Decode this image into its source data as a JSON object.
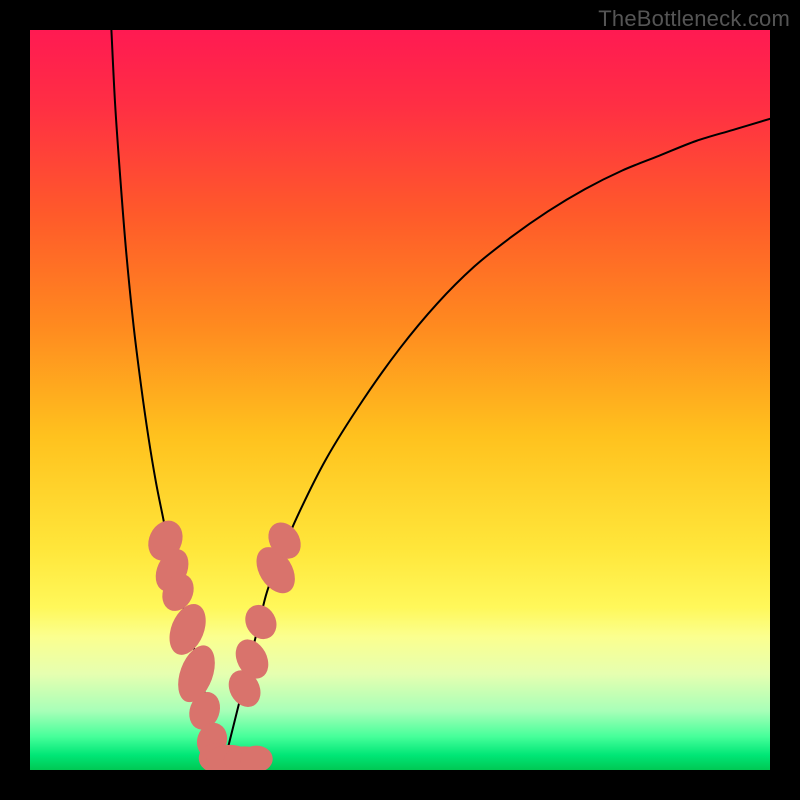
{
  "watermark": "TheBottleneck.com",
  "chart_data": {
    "type": "line",
    "title": "",
    "xlabel": "",
    "ylabel": "",
    "xlim": [
      0,
      100
    ],
    "ylim": [
      0,
      100
    ],
    "grid": false,
    "background_gradient": {
      "stops": [
        {
          "offset": 0.0,
          "color": "#ff1a52"
        },
        {
          "offset": 0.1,
          "color": "#ff2e44"
        },
        {
          "offset": 0.25,
          "color": "#ff5a2a"
        },
        {
          "offset": 0.4,
          "color": "#ff8a1f"
        },
        {
          "offset": 0.55,
          "color": "#ffc21e"
        },
        {
          "offset": 0.7,
          "color": "#ffe63a"
        },
        {
          "offset": 0.78,
          "color": "#fff85a"
        },
        {
          "offset": 0.82,
          "color": "#fbff8f"
        },
        {
          "offset": 0.87,
          "color": "#e6ffb0"
        },
        {
          "offset": 0.92,
          "color": "#a8ffb8"
        },
        {
          "offset": 0.955,
          "color": "#46ff9a"
        },
        {
          "offset": 0.98,
          "color": "#00e676"
        },
        {
          "offset": 1.0,
          "color": "#00c853"
        }
      ]
    },
    "series": [
      {
        "name": "curve-left",
        "x": [
          11,
          11.5,
          12.2,
          13,
          14,
          15,
          16,
          17,
          18,
          18.8,
          19.5,
          20.2,
          21,
          21.8,
          22.5,
          23.2,
          24,
          24.5,
          25,
          25.5,
          26
        ],
        "y": [
          100,
          90,
          80,
          70,
          60,
          52,
          45,
          39,
          34,
          30,
          27,
          24,
          21,
          18,
          15,
          12,
          9,
          7,
          5,
          3,
          0
        ],
        "stroke": "#000000",
        "stroke_width": 2
      },
      {
        "name": "curve-right",
        "x": [
          26,
          27,
          28,
          29,
          30,
          31,
          32,
          33.5,
          36,
          40,
          45,
          50,
          55,
          60,
          65,
          70,
          75,
          80,
          85,
          90,
          95,
          100
        ],
        "y": [
          0,
          4,
          8,
          12,
          16,
          20,
          24,
          28,
          34,
          42,
          50,
          57,
          63,
          68,
          72,
          75.5,
          78.5,
          81,
          83,
          85,
          86.5,
          88
        ],
        "stroke": "#000000",
        "stroke_width": 2
      }
    ],
    "scatter": {
      "name": "bead-markers",
      "color": "#d9736c",
      "points": [
        {
          "x": 18.3,
          "y": 31,
          "rx": 2.2,
          "ry": 2.8,
          "rot": 25
        },
        {
          "x": 19.2,
          "y": 27,
          "rx": 2.0,
          "ry": 3.0,
          "rot": 25
        },
        {
          "x": 20.0,
          "y": 24,
          "rx": 2.0,
          "ry": 2.6,
          "rot": 25
        },
        {
          "x": 21.3,
          "y": 19,
          "rx": 2.2,
          "ry": 3.6,
          "rot": 22
        },
        {
          "x": 22.5,
          "y": 13,
          "rx": 2.2,
          "ry": 4.0,
          "rot": 20
        },
        {
          "x": 23.6,
          "y": 8,
          "rx": 2.0,
          "ry": 2.6,
          "rot": 20
        },
        {
          "x": 24.6,
          "y": 4,
          "rx": 2.0,
          "ry": 2.4,
          "rot": 18
        },
        {
          "x": 25.2,
          "y": 1.6,
          "rx": 2.4,
          "ry": 2.0,
          "rot": 0
        },
        {
          "x": 27.0,
          "y": 1.4,
          "rx": 3.2,
          "ry": 2.0,
          "rot": 0
        },
        {
          "x": 29.0,
          "y": 1.4,
          "rx": 2.8,
          "ry": 1.8,
          "rot": 0
        },
        {
          "x": 30.6,
          "y": 1.5,
          "rx": 2.2,
          "ry": 1.8,
          "rot": 0
        },
        {
          "x": 29.0,
          "y": 11,
          "rx": 2.0,
          "ry": 2.6,
          "rot": -28
        },
        {
          "x": 30.0,
          "y": 15,
          "rx": 2.0,
          "ry": 2.8,
          "rot": -28
        },
        {
          "x": 31.2,
          "y": 20,
          "rx": 2.0,
          "ry": 2.4,
          "rot": -30
        },
        {
          "x": 33.2,
          "y": 27,
          "rx": 2.2,
          "ry": 3.4,
          "rot": -32
        },
        {
          "x": 34.4,
          "y": 31,
          "rx": 2.0,
          "ry": 2.6,
          "rot": -32
        }
      ]
    }
  }
}
